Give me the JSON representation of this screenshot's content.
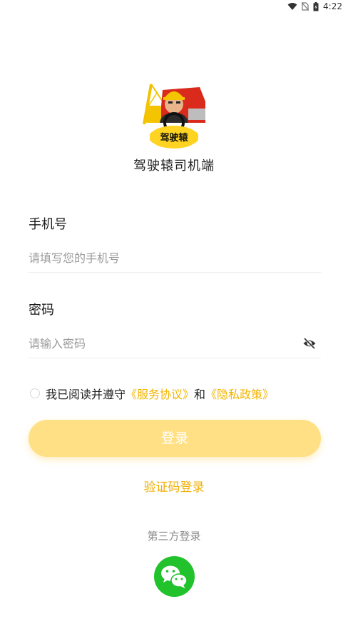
{
  "status_bar": {
    "time": "4:22",
    "icons": [
      "wifi-icon",
      "no-sim-icon",
      "battery-icon"
    ]
  },
  "app": {
    "name": "驾驶辕司机端",
    "logo_text": "驾驶辕"
  },
  "phone": {
    "label": "手机号",
    "placeholder": "请填写您的手机号",
    "value": ""
  },
  "password": {
    "label": "密码",
    "placeholder": "请输入密码",
    "value": "",
    "visibility_icon": "eye-off-icon"
  },
  "agreement": {
    "prefix": "我已阅读并遵守",
    "service_link": "《服务协议》",
    "connector": "和",
    "privacy_link": "《隐私政策》",
    "checked": false
  },
  "login_button": "登录",
  "sms_login": "验证码登录",
  "third_party": {
    "label": "第三方登录",
    "providers": [
      "wechat-icon"
    ]
  },
  "colors": {
    "accent": "#f3b400",
    "button_bg": "#ffe085",
    "wechat": "#21c22c"
  }
}
